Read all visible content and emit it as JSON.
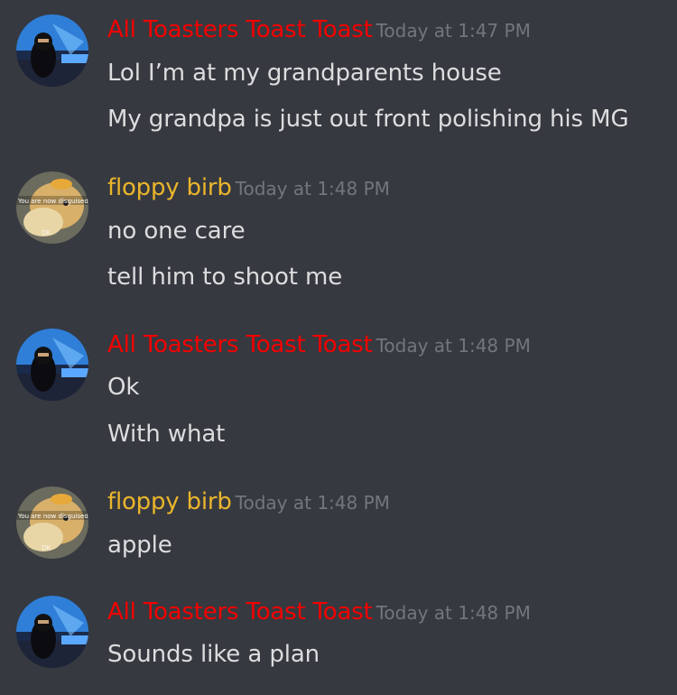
{
  "colors": {
    "background": "#36393f",
    "text": "#dcddde",
    "timestamp": "#72767d"
  },
  "messages": [
    {
      "author": "All Toasters Toast Toast",
      "author_color": "#f40000",
      "avatar": "toaster-avatar",
      "timestamp": "Today at 1:47 PM",
      "lines": [
        "Lol I’m at my grandparents house",
        "My grandpa is just out front polishing his MG"
      ]
    },
    {
      "author": "floppy birb",
      "author_color": "#eab52c",
      "avatar": "bird-avatar",
      "avatar_caption": "You are now disguised",
      "timestamp": "Today at 1:48 PM",
      "lines": [
        "no one care",
        "tell him to shoot me"
      ]
    },
    {
      "author": "All Toasters Toast Toast",
      "author_color": "#f40000",
      "avatar": "toaster-avatar",
      "timestamp": "Today at 1:48 PM",
      "lines": [
        "Ok",
        "With what"
      ]
    },
    {
      "author": "floppy birb",
      "author_color": "#eab52c",
      "avatar": "bird-avatar",
      "avatar_caption": "You are now disguised",
      "timestamp": "Today at 1:48 PM",
      "lines": [
        "apple"
      ]
    },
    {
      "author": "All Toasters Toast Toast",
      "author_color": "#f40000",
      "avatar": "toaster-avatar",
      "timestamp": "Today at 1:48 PM",
      "lines": [
        "Sounds like a plan"
      ]
    }
  ]
}
